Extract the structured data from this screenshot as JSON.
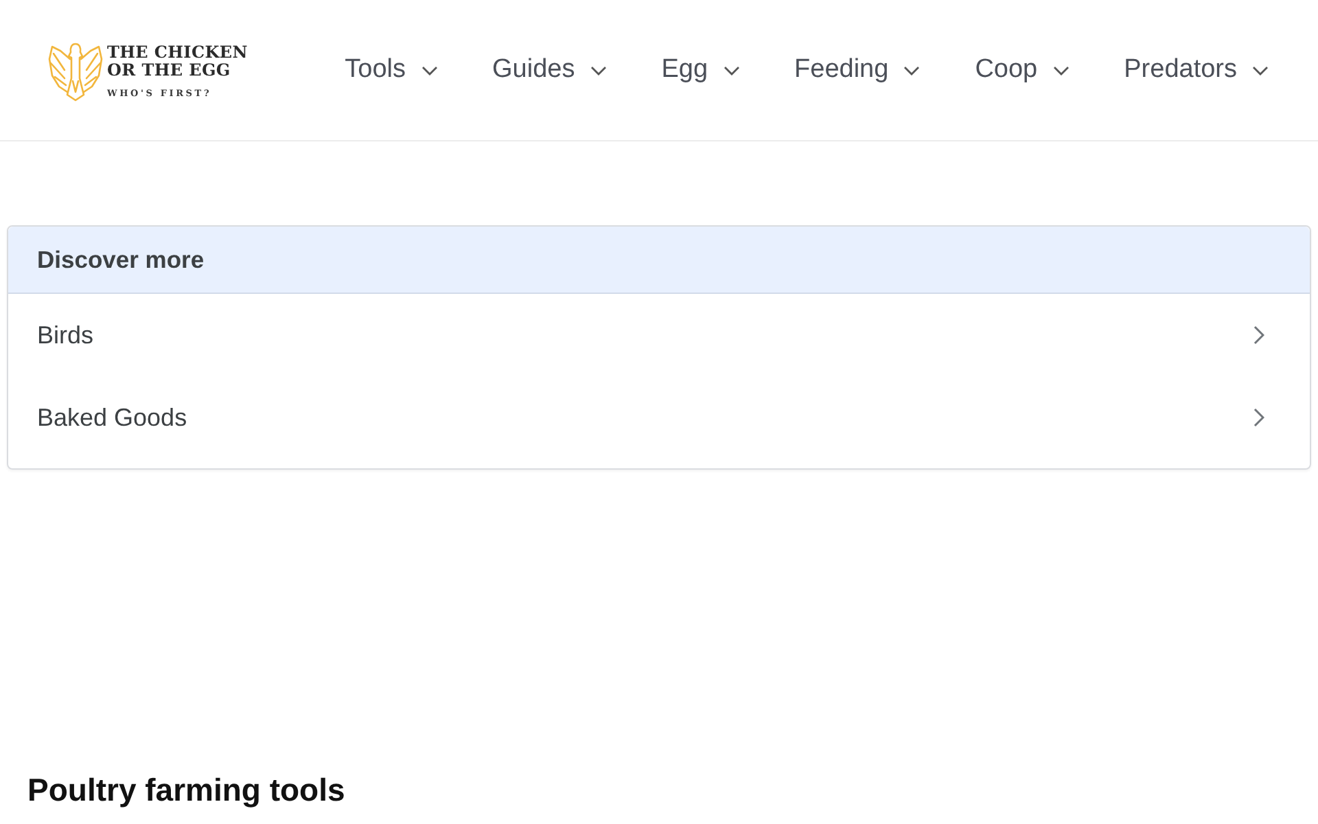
{
  "header": {
    "logo": {
      "title_lines": [
        "THE CHICKEN",
        "OR THE EGG"
      ],
      "tagline": "WHO'S FIRST?"
    },
    "nav": [
      {
        "label": "Tools"
      },
      {
        "label": "Guides"
      },
      {
        "label": "Egg"
      },
      {
        "label": "Feeding"
      },
      {
        "label": "Coop"
      },
      {
        "label": "Predators"
      }
    ]
  },
  "discover": {
    "title": "Discover more",
    "items": [
      {
        "label": "Birds"
      },
      {
        "label": "Baked Goods"
      }
    ]
  },
  "section_heading": "Poultry farming tools"
}
